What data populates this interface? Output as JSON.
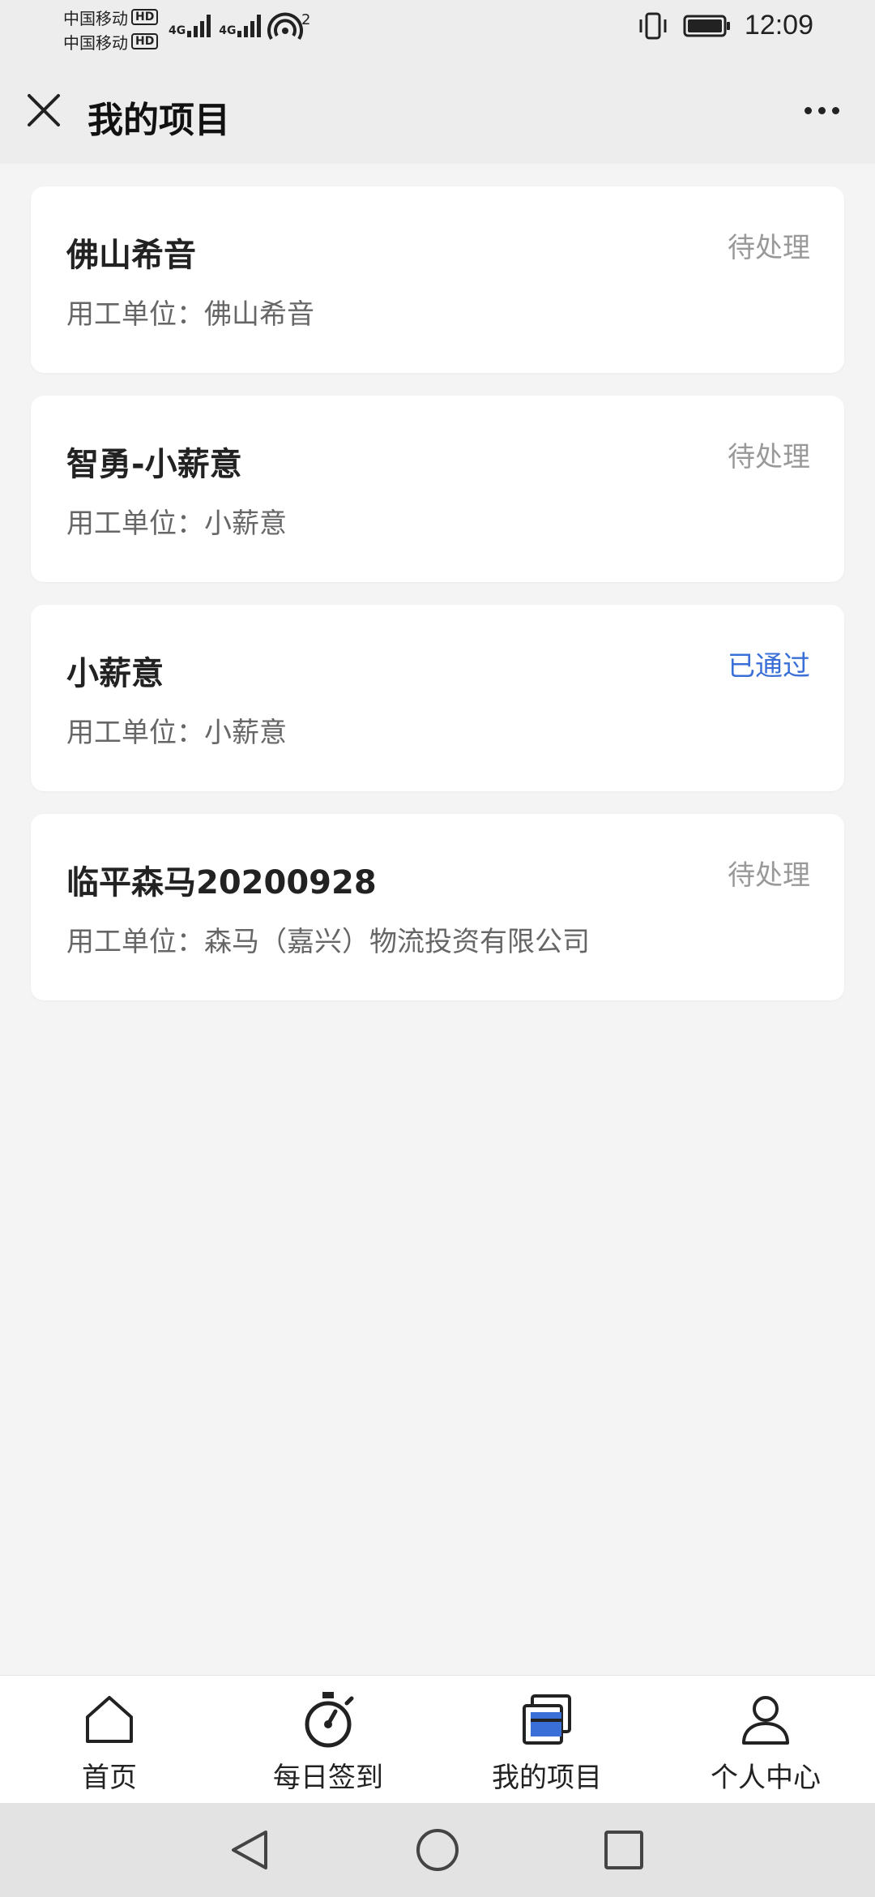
{
  "status_bar": {
    "carrier_1": "中国移动",
    "carrier_2": "中国移动",
    "hd_label": "HD",
    "network_1": "4G",
    "network_2": "4G",
    "hotspot_count": "2",
    "time": "12:09",
    "icons": [
      "signal-icon",
      "hotspot-icon",
      "vibrate-icon",
      "battery-icon"
    ]
  },
  "header": {
    "title": "我的项目",
    "icons": [
      "close-icon",
      "more-icon"
    ]
  },
  "projects": [
    {
      "name": "佛山希音",
      "status": "待处理",
      "employer": "用工单位：佛山希音"
    },
    {
      "name": "智勇-小薪意",
      "status": "待处理",
      "employer": "用工单位：小薪意"
    },
    {
      "name": "小薪意",
      "status": "已通过",
      "employer": "用工单位：小薪意"
    },
    {
      "name": "临平森马20200928",
      "status": "待处理",
      "employer": "用工单位：森马（嘉兴）物流投资有限公司"
    }
  ],
  "tabbar": {
    "tabs": [
      {
        "label": "首页",
        "icon": "home-icon"
      },
      {
        "label": "每日签到",
        "icon": "stopwatch-icon"
      },
      {
        "label": "我的项目",
        "icon": "projects-icon",
        "active": true
      },
      {
        "label": "个人中心",
        "icon": "person-icon"
      }
    ]
  },
  "colors": {
    "accent": "#3a6fd8",
    "pending": "#999999",
    "background": "#f4f4f4"
  }
}
